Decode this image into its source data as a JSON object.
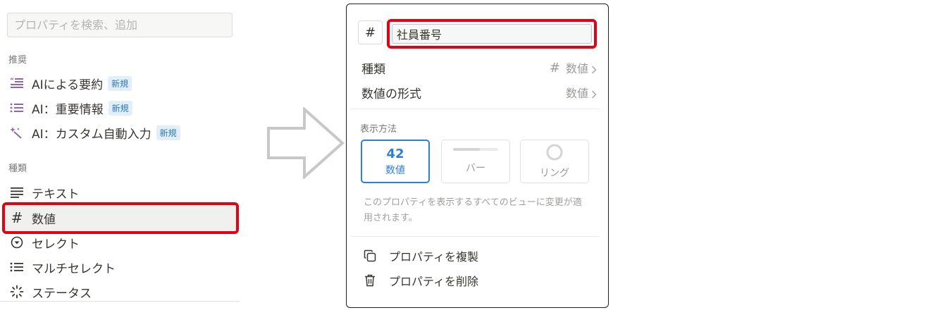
{
  "left_panel": {
    "search_placeholder": "プロパティを検索、追加",
    "recommended_label": "推奨",
    "recommended_items": [
      {
        "label": "AIによる要約",
        "badge": "新規",
        "icon": "ai-summary-icon"
      },
      {
        "label": "AI：重要情報",
        "badge": "新規",
        "icon": "ai-key-info-icon"
      },
      {
        "label": "AI：カスタム自動入力",
        "badge": "新規",
        "icon": "magic-wand-icon"
      }
    ],
    "types_label": "種類",
    "type_items": [
      {
        "label": "テキスト",
        "icon": "text-lines-icon"
      },
      {
        "label": "数値",
        "icon": "hash-icon",
        "highlighted": true
      },
      {
        "label": "セレクト",
        "icon": "select-circle-icon"
      },
      {
        "label": "マルチセレクト",
        "icon": "list-icon"
      },
      {
        "label": "ステータス",
        "icon": "status-loader-icon"
      }
    ]
  },
  "popup": {
    "type_icon": "#",
    "name_value": "社員番号",
    "rows": {
      "type": {
        "label": "種類",
        "value_icon": "#",
        "value": "数値"
      },
      "format": {
        "label": "数値の形式",
        "value": "数値"
      }
    },
    "display_label": "表示方法",
    "display_options": {
      "number": {
        "value": "42",
        "label": "数値",
        "selected": true
      },
      "bar": {
        "label": "バー",
        "fill_fraction": 0.6
      },
      "ring": {
        "label": "リング"
      }
    },
    "display_desc": "このプロパティを表示するすべてのビューに変更が適用されます。",
    "actions": {
      "duplicate": "プロパティを複製",
      "delete": "プロパティを削除"
    }
  },
  "colors": {
    "highlight_red": "#e60012",
    "accent_blue": "#2e7fd1",
    "ai_purple": "#9065b0"
  }
}
